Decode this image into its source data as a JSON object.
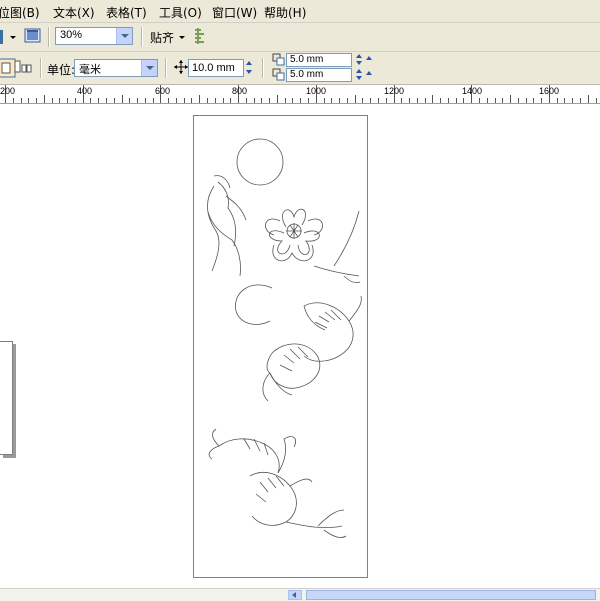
{
  "menu": {
    "items": [
      {
        "label": "位图(B)"
      },
      {
        "label": "文本(X)"
      },
      {
        "label": "表格(T)"
      },
      {
        "label": "工具(O)"
      },
      {
        "label": "窗口(W)"
      },
      {
        "label": "帮助(H)"
      }
    ]
  },
  "toolbar": {
    "zoom_value": "30%",
    "snap_label": "贴齐"
  },
  "property_bar": {
    "unit_label": "单位:",
    "unit_value": "毫米",
    "nudge_value": "10.0 mm",
    "dup_x_value": "5.0 mm",
    "dup_y_value": "5.0 mm"
  },
  "ruler": {
    "labels": [
      "200",
      "400",
      "600",
      "800",
      "1000",
      "1200",
      "1400",
      "1600"
    ]
  }
}
